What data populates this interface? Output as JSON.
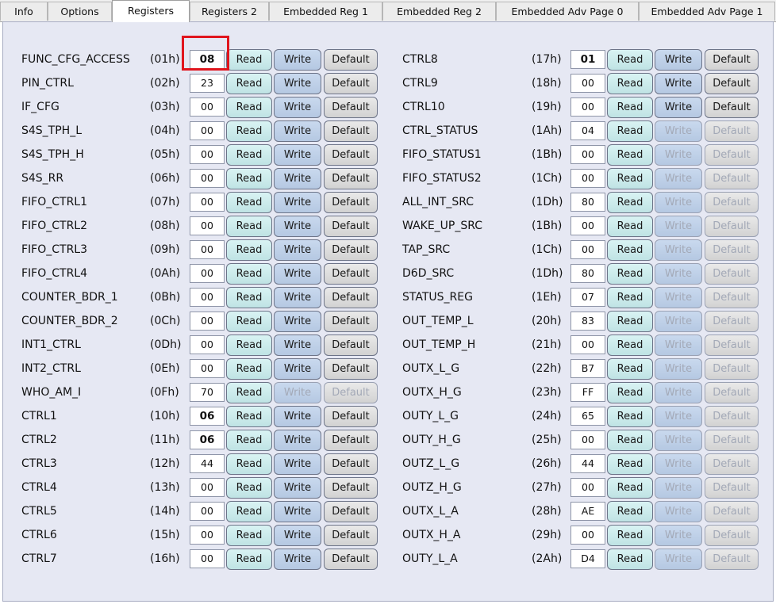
{
  "tabs": [
    {
      "label": "Info",
      "active": false
    },
    {
      "label": "Options",
      "active": false
    },
    {
      "label": "Registers",
      "active": true
    },
    {
      "label": "Registers 2",
      "active": false
    },
    {
      "label": "Embedded Reg 1",
      "active": false
    },
    {
      "label": "Embedded Reg 2",
      "active": false
    },
    {
      "label": "Embedded Adv Page 0",
      "active": false
    },
    {
      "label": "Embedded Adv Page 1",
      "active": false
    }
  ],
  "buttons": {
    "read": "Read",
    "write": "Write",
    "default": "Default"
  },
  "colors": {
    "highlight": "#e0151d",
    "panel": "#e6e8f3"
  },
  "registers_left": [
    {
      "name": "FUNC_CFG_ACCESS",
      "addr": "(01h)",
      "value": "08",
      "bold": true,
      "write_enabled": true,
      "default_enabled": true
    },
    {
      "name": "PIN_CTRL",
      "addr": "(02h)",
      "value": "23",
      "bold": false,
      "write_enabled": true,
      "default_enabled": true
    },
    {
      "name": "IF_CFG",
      "addr": "(03h)",
      "value": "00",
      "bold": false,
      "write_enabled": true,
      "default_enabled": true
    },
    {
      "name": "S4S_TPH_L",
      "addr": "(04h)",
      "value": "00",
      "bold": false,
      "write_enabled": true,
      "default_enabled": true
    },
    {
      "name": "S4S_TPH_H",
      "addr": "(05h)",
      "value": "00",
      "bold": false,
      "write_enabled": true,
      "default_enabled": true
    },
    {
      "name": "S4S_RR",
      "addr": "(06h)",
      "value": "00",
      "bold": false,
      "write_enabled": true,
      "default_enabled": true
    },
    {
      "name": "FIFO_CTRL1",
      "addr": "(07h)",
      "value": "00",
      "bold": false,
      "write_enabled": true,
      "default_enabled": true
    },
    {
      "name": "FIFO_CTRL2",
      "addr": "(08h)",
      "value": "00",
      "bold": false,
      "write_enabled": true,
      "default_enabled": true
    },
    {
      "name": "FIFO_CTRL3",
      "addr": "(09h)",
      "value": "00",
      "bold": false,
      "write_enabled": true,
      "default_enabled": true
    },
    {
      "name": "FIFO_CTRL4",
      "addr": "(0Ah)",
      "value": "00",
      "bold": false,
      "write_enabled": true,
      "default_enabled": true
    },
    {
      "name": "COUNTER_BDR_1",
      "addr": "(0Bh)",
      "value": "00",
      "bold": false,
      "write_enabled": true,
      "default_enabled": true
    },
    {
      "name": "COUNTER_BDR_2",
      "addr": "(0Ch)",
      "value": "00",
      "bold": false,
      "write_enabled": true,
      "default_enabled": true
    },
    {
      "name": "INT1_CTRL",
      "addr": "(0Dh)",
      "value": "00",
      "bold": false,
      "write_enabled": true,
      "default_enabled": true
    },
    {
      "name": "INT2_CTRL",
      "addr": "(0Eh)",
      "value": "00",
      "bold": false,
      "write_enabled": true,
      "default_enabled": true
    },
    {
      "name": "WHO_AM_I",
      "addr": "(0Fh)",
      "value": "70",
      "bold": false,
      "write_enabled": false,
      "default_enabled": false
    },
    {
      "name": "CTRL1",
      "addr": "(10h)",
      "value": "06",
      "bold": true,
      "write_enabled": true,
      "default_enabled": true
    },
    {
      "name": "CTRL2",
      "addr": "(11h)",
      "value": "06",
      "bold": true,
      "write_enabled": true,
      "default_enabled": true
    },
    {
      "name": "CTRL3",
      "addr": "(12h)",
      "value": "44",
      "bold": false,
      "write_enabled": true,
      "default_enabled": true
    },
    {
      "name": "CTRL4",
      "addr": "(13h)",
      "value": "00",
      "bold": false,
      "write_enabled": true,
      "default_enabled": true
    },
    {
      "name": "CTRL5",
      "addr": "(14h)",
      "value": "00",
      "bold": false,
      "write_enabled": true,
      "default_enabled": true
    },
    {
      "name": "CTRL6",
      "addr": "(15h)",
      "value": "00",
      "bold": false,
      "write_enabled": true,
      "default_enabled": true
    },
    {
      "name": "CTRL7",
      "addr": "(16h)",
      "value": "00",
      "bold": false,
      "write_enabled": true,
      "default_enabled": true
    }
  ],
  "registers_right": [
    {
      "name": "CTRL8",
      "addr": "(17h)",
      "value": "01",
      "bold": true,
      "write_enabled": true,
      "default_enabled": true
    },
    {
      "name": "CTRL9",
      "addr": "(18h)",
      "value": "00",
      "bold": false,
      "write_enabled": true,
      "default_enabled": true
    },
    {
      "name": "CTRL10",
      "addr": "(19h)",
      "value": "00",
      "bold": false,
      "write_enabled": true,
      "default_enabled": true
    },
    {
      "name": "CTRL_STATUS",
      "addr": "(1Ah)",
      "value": "04",
      "bold": false,
      "write_enabled": false,
      "default_enabled": false
    },
    {
      "name": "FIFO_STATUS1",
      "addr": "(1Bh)",
      "value": "00",
      "bold": false,
      "write_enabled": false,
      "default_enabled": false
    },
    {
      "name": "FIFO_STATUS2",
      "addr": "(1Ch)",
      "value": "00",
      "bold": false,
      "write_enabled": false,
      "default_enabled": false
    },
    {
      "name": "ALL_INT_SRC",
      "addr": "(1Dh)",
      "value": "80",
      "bold": false,
      "write_enabled": false,
      "default_enabled": false
    },
    {
      "name": "WAKE_UP_SRC",
      "addr": "(1Bh)",
      "value": "00",
      "bold": false,
      "write_enabled": false,
      "default_enabled": false
    },
    {
      "name": "TAP_SRC",
      "addr": "(1Ch)",
      "value": "00",
      "bold": false,
      "write_enabled": false,
      "default_enabled": false
    },
    {
      "name": "D6D_SRC",
      "addr": "(1Dh)",
      "value": "80",
      "bold": false,
      "write_enabled": false,
      "default_enabled": false
    },
    {
      "name": "STATUS_REG",
      "addr": "(1Eh)",
      "value": "07",
      "bold": false,
      "write_enabled": false,
      "default_enabled": false
    },
    {
      "name": "OUT_TEMP_L",
      "addr": "(20h)",
      "value": "83",
      "bold": false,
      "write_enabled": false,
      "default_enabled": false
    },
    {
      "name": "OUT_TEMP_H",
      "addr": "(21h)",
      "value": "00",
      "bold": false,
      "write_enabled": false,
      "default_enabled": false
    },
    {
      "name": "OUTX_L_G",
      "addr": "(22h)",
      "value": "B7",
      "bold": false,
      "write_enabled": false,
      "default_enabled": false
    },
    {
      "name": "OUTX_H_G",
      "addr": "(23h)",
      "value": "FF",
      "bold": false,
      "write_enabled": false,
      "default_enabled": false
    },
    {
      "name": "OUTY_L_G",
      "addr": "(24h)",
      "value": "65",
      "bold": false,
      "write_enabled": false,
      "default_enabled": false
    },
    {
      "name": "OUTY_H_G",
      "addr": "(25h)",
      "value": "00",
      "bold": false,
      "write_enabled": false,
      "default_enabled": false
    },
    {
      "name": "OUTZ_L_G",
      "addr": "(26h)",
      "value": "44",
      "bold": false,
      "write_enabled": false,
      "default_enabled": false
    },
    {
      "name": "OUTZ_H_G",
      "addr": "(27h)",
      "value": "00",
      "bold": false,
      "write_enabled": false,
      "default_enabled": false
    },
    {
      "name": "OUTX_L_A",
      "addr": "(28h)",
      "value": "AE",
      "bold": false,
      "write_enabled": false,
      "default_enabled": false
    },
    {
      "name": "OUTX_H_A",
      "addr": "(29h)",
      "value": "00",
      "bold": false,
      "write_enabled": false,
      "default_enabled": false
    },
    {
      "name": "OUTY_L_A",
      "addr": "(2Ah)",
      "value": "D4",
      "bold": false,
      "write_enabled": false,
      "default_enabled": false
    }
  ]
}
